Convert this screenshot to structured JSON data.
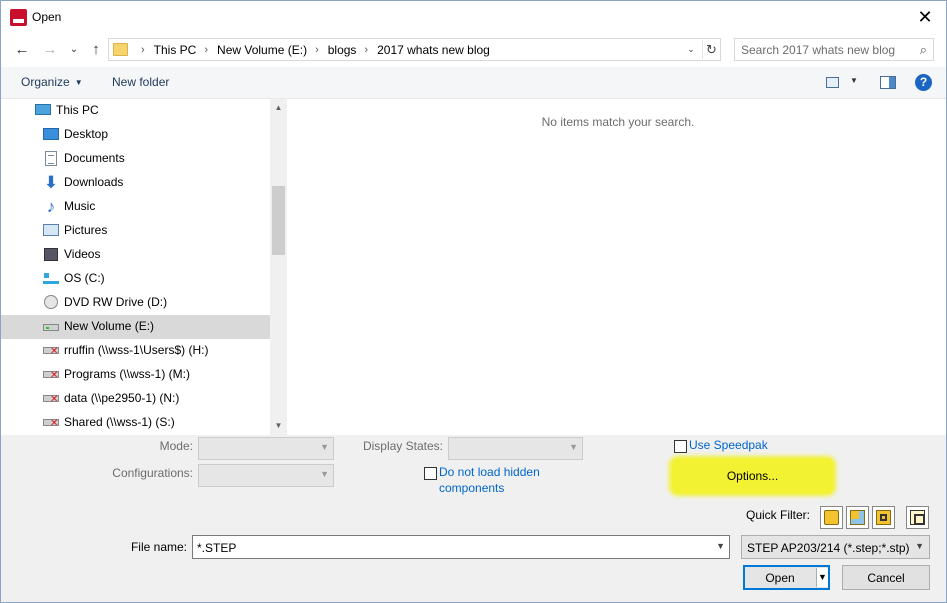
{
  "window": {
    "title": "Open",
    "close_glyph": "✕"
  },
  "nav_buttons": {
    "back": "←",
    "forward": "→",
    "up": "↑",
    "recent": "⌄"
  },
  "address": {
    "crumbs": [
      "This PC",
      "New Volume (E:)",
      "blogs",
      "2017 whats new blog"
    ],
    "separator": "›",
    "dropdown_glyph": "⌄",
    "refresh_glyph": "↻"
  },
  "search": {
    "placeholder": "Search 2017 whats new blog",
    "icon": "search-icon",
    "glyph": "⌕"
  },
  "toolbar": {
    "organize": "Organize",
    "new_folder": "New folder",
    "help_glyph": "?"
  },
  "nav_tree": {
    "items": [
      {
        "label": "This PC",
        "icon": "this-pc-icon"
      },
      {
        "label": "Desktop",
        "icon": "desktop-icon"
      },
      {
        "label": "Documents",
        "icon": "documents-icon"
      },
      {
        "label": "Downloads",
        "icon": "downloads-icon"
      },
      {
        "label": "Music",
        "icon": "music-icon"
      },
      {
        "label": "Pictures",
        "icon": "pictures-icon"
      },
      {
        "label": "Videos",
        "icon": "videos-icon"
      },
      {
        "label": "OS (C:)",
        "icon": "os-drive-icon"
      },
      {
        "label": "DVD RW Drive (D:)",
        "icon": "dvd-drive-icon"
      },
      {
        "label": "New Volume (E:)",
        "icon": "drive-icon",
        "selected": true
      },
      {
        "label": "rruffin (\\\\wss-1\\Users$) (H:)",
        "icon": "disconnected-network-drive-icon"
      },
      {
        "label": "Programs (\\\\wss-1) (M:)",
        "icon": "disconnected-network-drive-icon"
      },
      {
        "label": "data (\\\\pe2950-1) (N:)",
        "icon": "disconnected-network-drive-icon"
      },
      {
        "label": "Shared (\\\\wss-1) (S:)",
        "icon": "disconnected-network-drive-icon"
      }
    ]
  },
  "content": {
    "empty_message": "No items match your search."
  },
  "options_panel": {
    "mode_label": "Mode:",
    "display_states_label": "Display States:",
    "configurations_label": "Configurations:",
    "use_speedpak": "Use Speedpak",
    "do_not_load_hidden_line1": "Do not load hidden",
    "do_not_load_hidden_line2": "components",
    "options_button": "Options...",
    "highlight_color": "#f2f233"
  },
  "quick_filter": {
    "label": "Quick Filter:",
    "buttons": [
      "filter-parts-icon",
      "filter-assemblies-icon",
      "filter-drawings-icon",
      "filter-top-level-assemblies-icon"
    ]
  },
  "file_name": {
    "label": "File name:",
    "value": "*.STEP"
  },
  "file_type": {
    "value": "STEP AP203/214 (*.step;*.stp)"
  },
  "buttons": {
    "open": "Open",
    "cancel": "Cancel"
  },
  "colors": {
    "accent": "#0078d7",
    "link": "#0066cc",
    "selected_row": "#d9d9d9"
  }
}
